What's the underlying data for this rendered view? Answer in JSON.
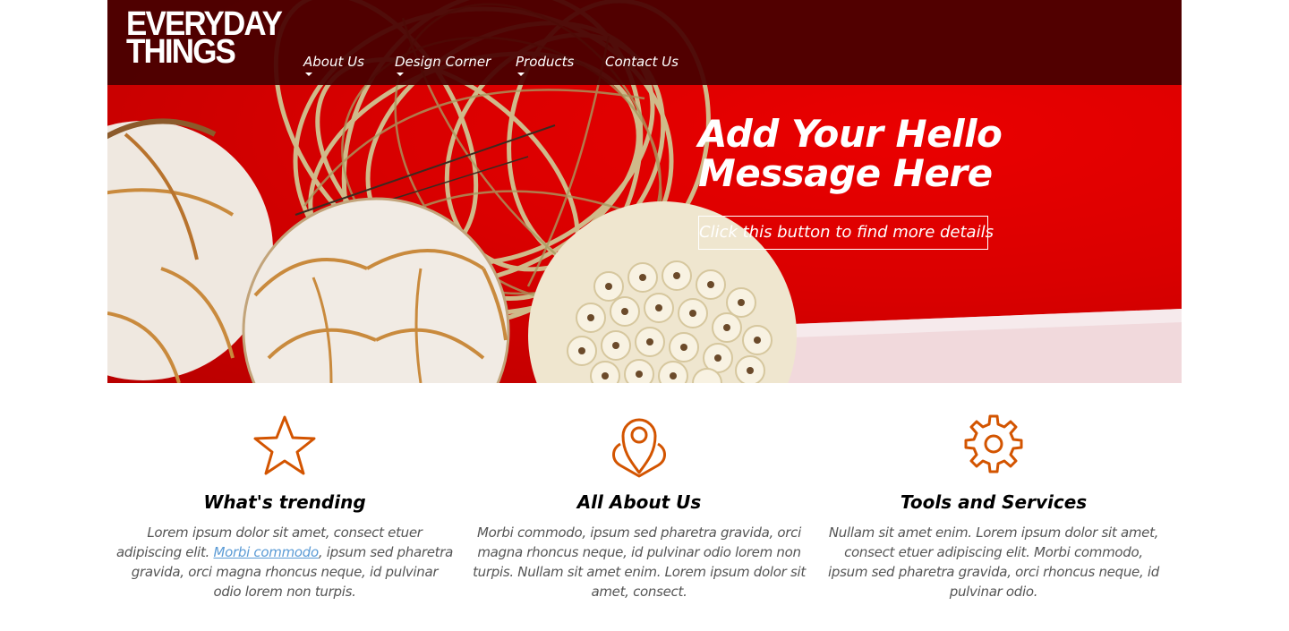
{
  "brand": {
    "line1": "EVERYDAY",
    "line2": "THINGS"
  },
  "nav": {
    "items": [
      {
        "label": "About Us"
      },
      {
        "label": "Design Corner"
      },
      {
        "label": "Products"
      },
      {
        "label": "Contact Us"
      }
    ]
  },
  "hero": {
    "title": "Add Your Hello Message Here",
    "button_label": "Click this button to find more details"
  },
  "features": [
    {
      "icon": "star-icon",
      "title": "What's trending",
      "text_before": "Lorem ipsum dolor sit amet, consect etuer adipiscing elit. ",
      "link": "Morbi commodo",
      "text_after": ", ipsum sed pharetra gravida, orci magna rhoncus neque, id pulvinar odio lorem non turpis."
    },
    {
      "icon": "location-pin-icon",
      "title": "All About Us",
      "text": "Morbi commodo, ipsum sed pharetra gravida, orci magna rhoncus neque, id pulvinar odio lorem non turpis. Nullam sit amet enim. Lorem ipsum dolor sit amet, consect."
    },
    {
      "icon": "gear-icon",
      "title": "Tools and Services",
      "text": "Nullam sit amet enim. Lorem ipsum dolor sit amet, consect etuer adipiscing elit. Morbi commodo, ipsum sed pharetra gravida, orci rhoncus neque, id pulvinar odio."
    }
  ],
  "colors": {
    "header_bar": "#4a0000",
    "hero_background": "#e00000",
    "accent_icon": "#d35400",
    "link": "#5b9bd5"
  }
}
